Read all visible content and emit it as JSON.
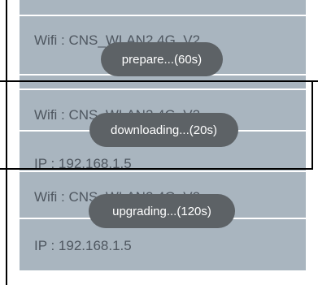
{
  "panels": [
    {
      "wifi_label": "Wifi : CNS_WLAN2.4G_V2",
      "toast": "prepare...(60s)"
    },
    {
      "wifi_label": "Wifi : CNS_WLAN2.4G_V2",
      "ip_label": "IP : 192.168.1.5",
      "toast": "downloading...(20s)"
    },
    {
      "wifi_label": "Wifi : CNS_WLAN2.4G_V2",
      "ip_label": "IP : 192.168.1.5",
      "toast": "upgrading...(120s)"
    }
  ],
  "colors": {
    "card_background": "#a9b5bf",
    "toast_background": "#5d6266",
    "text": "#4f5760"
  }
}
